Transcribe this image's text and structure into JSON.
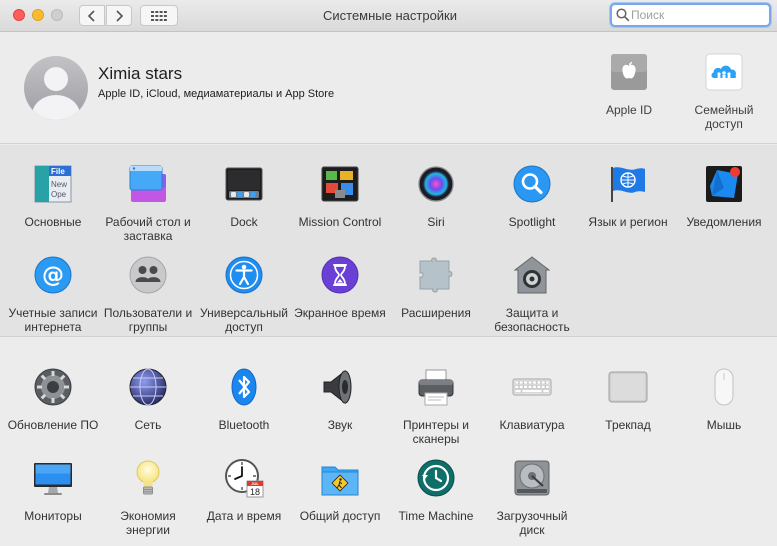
{
  "window": {
    "title": "Системные настройки",
    "search_placeholder": "Поиск"
  },
  "account": {
    "name": "Ximia stars",
    "subtitle": "Apple ID, iCloud, медиаматериалы и App Store",
    "items": [
      {
        "label": "Apple ID",
        "icon": "apple-icon"
      },
      {
        "label": "Семейный доступ",
        "icon": "family-sharing-icon"
      }
    ]
  },
  "section1": [
    {
      "label": "Основные",
      "icon": "general-icon"
    },
    {
      "label": "Рабочий стол и заставка",
      "icon": "desktop-screensaver-icon"
    },
    {
      "label": "Dock",
      "icon": "dock-icon"
    },
    {
      "label": "Mission Control",
      "icon": "mission-control-icon"
    },
    {
      "label": "Siri",
      "icon": "siri-icon"
    },
    {
      "label": "Spotlight",
      "icon": "spotlight-icon"
    },
    {
      "label": "Язык и регион",
      "icon": "language-region-icon"
    },
    {
      "label": "Уведомления",
      "icon": "notifications-icon"
    },
    {
      "label": "Учетные записи интернета",
      "icon": "internet-accounts-icon"
    },
    {
      "label": "Пользователи и группы",
      "icon": "users-groups-icon"
    },
    {
      "label": "Универсальный доступ",
      "icon": "accessibility-icon"
    },
    {
      "label": "Экранное время",
      "icon": "screen-time-icon"
    },
    {
      "label": "Расширения",
      "icon": "extensions-icon"
    },
    {
      "label": "Защита и безопасность",
      "icon": "security-privacy-icon"
    }
  ],
  "section2": [
    {
      "label": "Обновление ПО",
      "icon": "software-update-icon"
    },
    {
      "label": "Сеть",
      "icon": "network-icon"
    },
    {
      "label": "Bluetooth",
      "icon": "bluetooth-icon"
    },
    {
      "label": "Звук",
      "icon": "sound-icon"
    },
    {
      "label": "Принтеры и сканеры",
      "icon": "printers-scanners-icon"
    },
    {
      "label": "Клавиатура",
      "icon": "keyboard-icon"
    },
    {
      "label": "Трекпад",
      "icon": "trackpad-icon"
    },
    {
      "label": "Мышь",
      "icon": "mouse-icon"
    },
    {
      "label": "Мониторы",
      "icon": "displays-icon"
    },
    {
      "label": "Экономия энергии",
      "icon": "energy-saver-icon"
    },
    {
      "label": "Дата и время",
      "icon": "date-time-icon"
    },
    {
      "label": "Общий доступ",
      "icon": "sharing-icon"
    },
    {
      "label": "Time Machine",
      "icon": "time-machine-icon"
    },
    {
      "label": "Загрузочный диск",
      "icon": "startup-disk-icon"
    }
  ],
  "calendar_icon": {
    "month": "JUL",
    "day": "18"
  },
  "colors": {
    "accent": "#1b8cf0",
    "search_focus": "#7aa7e9",
    "close": "#fd5e57",
    "minimize": "#fdbb2e"
  }
}
